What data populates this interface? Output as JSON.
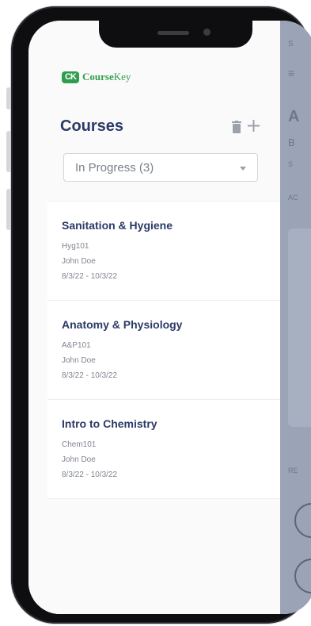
{
  "brand": {
    "mark": "CK",
    "name_bold": "Course",
    "name_light": "Key",
    "color": "#2f9e4f"
  },
  "header": {
    "title": "Courses"
  },
  "filter": {
    "selected": "In Progress (3)"
  },
  "courses": [
    {
      "name": "Sanitation & Hygiene",
      "code": "Hyg101",
      "instructor": "John Doe",
      "dates": "8/3/22 - 10/3/22"
    },
    {
      "name": "Anatomy & Physiology",
      "code": "A&P101",
      "instructor": "John Doe",
      "dates": "8/3/22 - 10/3/22"
    },
    {
      "name": "Intro to Chemistry",
      "code": "Chem101",
      "instructor": "John Doe",
      "dates": "8/3/22 - 10/3/22"
    }
  ],
  "overlay": {
    "letter": "A",
    "t1": "B",
    "t2": "S",
    "t3": "AC",
    "t4": "RE",
    "t5": "S"
  },
  "colors": {
    "title": "#2b3a67",
    "overlay": "#9aa4b6"
  }
}
